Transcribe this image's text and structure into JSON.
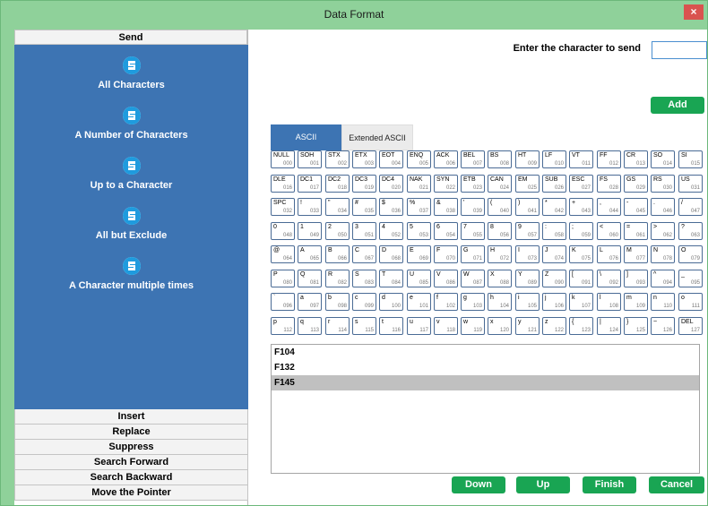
{
  "window": {
    "title": "Data Format",
    "close_glyph": "×"
  },
  "left": {
    "send_header": "Send",
    "options": [
      {
        "label": "All Characters",
        "icon": "s-app-icon"
      },
      {
        "label": "A Number of Characters",
        "icon": "s-app-icon"
      },
      {
        "label": "Up to a Character",
        "icon": "s-app-icon"
      },
      {
        "label": "All but Exclude",
        "icon": "s-app-icon"
      },
      {
        "label": "A Character multiple times",
        "icon": "s-app-icon"
      }
    ],
    "bottom_headers": [
      "Insert",
      "Replace",
      "Suppress",
      "Search Forward",
      "Search Backward",
      "Move the Pointer"
    ]
  },
  "right": {
    "char_label": "Enter the character to send",
    "char_value": "",
    "add_label": "Add",
    "tabs": [
      {
        "label": "ASCII",
        "active": true
      },
      {
        "label": "Extended ASCII",
        "active": false
      }
    ],
    "keys": [
      [
        "NULL",
        "000"
      ],
      [
        "SOH",
        "001"
      ],
      [
        "STX",
        "002"
      ],
      [
        "ETX",
        "003"
      ],
      [
        "EOT",
        "004"
      ],
      [
        "ENQ",
        "005"
      ],
      [
        "ACK",
        "006"
      ],
      [
        "BEL",
        "007"
      ],
      [
        "BS",
        "008"
      ],
      [
        "HT",
        "009"
      ],
      [
        "LF",
        "010"
      ],
      [
        "VT",
        "011"
      ],
      [
        "FF",
        "012"
      ],
      [
        "CR",
        "013"
      ],
      [
        "SO",
        "014"
      ],
      [
        "SI",
        "015"
      ],
      [
        "DLE",
        "016"
      ],
      [
        "DC1",
        "017"
      ],
      [
        "DC2",
        "018"
      ],
      [
        "DC3",
        "019"
      ],
      [
        "DC4",
        "020"
      ],
      [
        "NAK",
        "021"
      ],
      [
        "SYN",
        "022"
      ],
      [
        "ETB",
        "023"
      ],
      [
        "CAN",
        "024"
      ],
      [
        "EM",
        "025"
      ],
      [
        "SUB",
        "026"
      ],
      [
        "ESC",
        "027"
      ],
      [
        "FS",
        "028"
      ],
      [
        "GS",
        "029"
      ],
      [
        "RS",
        "030"
      ],
      [
        "US",
        "031"
      ],
      [
        "SPC",
        "032"
      ],
      [
        "!",
        "033"
      ],
      [
        "\"",
        "034"
      ],
      [
        "#",
        "035"
      ],
      [
        "$",
        "036"
      ],
      [
        "%",
        "037"
      ],
      [
        "&",
        "038"
      ],
      [
        "'",
        "039"
      ],
      [
        "(",
        "040"
      ],
      [
        ")",
        "041"
      ],
      [
        "*",
        "042"
      ],
      [
        "+",
        "043"
      ],
      [
        ",",
        "044"
      ],
      [
        "-",
        "045"
      ],
      [
        ".",
        "046"
      ],
      [
        "/",
        "047"
      ],
      [
        "0",
        "048"
      ],
      [
        "1",
        "049"
      ],
      [
        "2",
        "050"
      ],
      [
        "3",
        "051"
      ],
      [
        "4",
        "052"
      ],
      [
        "5",
        "053"
      ],
      [
        "6",
        "054"
      ],
      [
        "7",
        "055"
      ],
      [
        "8",
        "056"
      ],
      [
        "9",
        "057"
      ],
      [
        ":",
        "058"
      ],
      [
        ";",
        "059"
      ],
      [
        "<",
        "060"
      ],
      [
        "=",
        "061"
      ],
      [
        ">",
        "062"
      ],
      [
        "?",
        "063"
      ],
      [
        "@",
        "064"
      ],
      [
        "A",
        "065"
      ],
      [
        "B",
        "066"
      ],
      [
        "C",
        "067"
      ],
      [
        "D",
        "068"
      ],
      [
        "E",
        "069"
      ],
      [
        "F",
        "070"
      ],
      [
        "G",
        "071"
      ],
      [
        "H",
        "072"
      ],
      [
        "I",
        "073"
      ],
      [
        "J",
        "074"
      ],
      [
        "K",
        "075"
      ],
      [
        "L",
        "076"
      ],
      [
        "M",
        "077"
      ],
      [
        "N",
        "078"
      ],
      [
        "O",
        "079"
      ],
      [
        "P",
        "080"
      ],
      [
        "Q",
        "081"
      ],
      [
        "R",
        "082"
      ],
      [
        "S",
        "083"
      ],
      [
        "T",
        "084"
      ],
      [
        "U",
        "085"
      ],
      [
        "V",
        "086"
      ],
      [
        "W",
        "087"
      ],
      [
        "X",
        "088"
      ],
      [
        "Y",
        "089"
      ],
      [
        "Z",
        "090"
      ],
      [
        "[",
        "091"
      ],
      [
        "\\",
        "092"
      ],
      [
        "]",
        "093"
      ],
      [
        "^",
        "094"
      ],
      [
        "_",
        "095"
      ],
      [
        "`",
        "096"
      ],
      [
        "a",
        "097"
      ],
      [
        "b",
        "098"
      ],
      [
        "c",
        "099"
      ],
      [
        "d",
        "100"
      ],
      [
        "e",
        "101"
      ],
      [
        "f",
        "102"
      ],
      [
        "g",
        "103"
      ],
      [
        "h",
        "104"
      ],
      [
        "i",
        "105"
      ],
      [
        "j",
        "106"
      ],
      [
        "k",
        "107"
      ],
      [
        "l",
        "108"
      ],
      [
        "m",
        "109"
      ],
      [
        "n",
        "110"
      ],
      [
        "o",
        "111"
      ],
      [
        "p",
        "112"
      ],
      [
        "q",
        "113"
      ],
      [
        "r",
        "114"
      ],
      [
        "s",
        "115"
      ],
      [
        "t",
        "116"
      ],
      [
        "u",
        "117"
      ],
      [
        "v",
        "118"
      ],
      [
        "w",
        "119"
      ],
      [
        "x",
        "120"
      ],
      [
        "y",
        "121"
      ],
      [
        "z",
        "122"
      ],
      [
        "{",
        "123"
      ],
      [
        "|",
        "124"
      ],
      [
        "}",
        "125"
      ],
      [
        "~",
        "126"
      ],
      [
        "DEL",
        "127"
      ]
    ],
    "list_items": [
      {
        "text": "F104",
        "selected": false
      },
      {
        "text": "F132",
        "selected": false
      },
      {
        "text": "F145",
        "selected": true
      }
    ],
    "buttons": {
      "down": "Down",
      "up": "Up",
      "finish": "Finish",
      "cancel": "Cancel"
    }
  },
  "colors": {
    "title_bar": "#8fd19a",
    "panel_blue": "#3d74b3",
    "button_green": "#19a553",
    "close_red": "#d9534f"
  }
}
